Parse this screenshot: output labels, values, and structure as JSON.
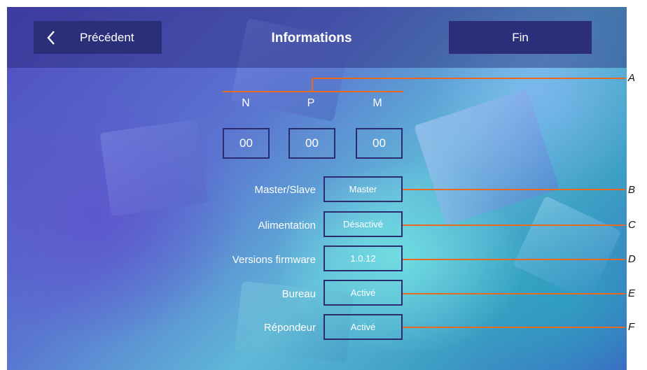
{
  "header": {
    "back_label": "Précédent",
    "title": "Informations",
    "end_label": "Fin"
  },
  "npm": {
    "labels": [
      "N",
      "P",
      "M"
    ],
    "values": [
      "00",
      "00",
      "00"
    ]
  },
  "rows": [
    {
      "label": "Master/Slave",
      "value": "Master"
    },
    {
      "label": "Alimentation",
      "value": "Désactivé"
    },
    {
      "label": "Versions firmware",
      "value": "1.0.12"
    },
    {
      "label": "Bureau",
      "value": "Activé"
    },
    {
      "label": "Répondeur",
      "value": "Activé"
    }
  ],
  "callouts": [
    "A",
    "B",
    "C",
    "D",
    "E",
    "F"
  ],
  "colors": {
    "button_bg": "#2b2f7a",
    "callout_line": "#e86a1e",
    "box_border": "#2a2c6e"
  },
  "icons": {
    "back": "chevron-left-icon"
  }
}
